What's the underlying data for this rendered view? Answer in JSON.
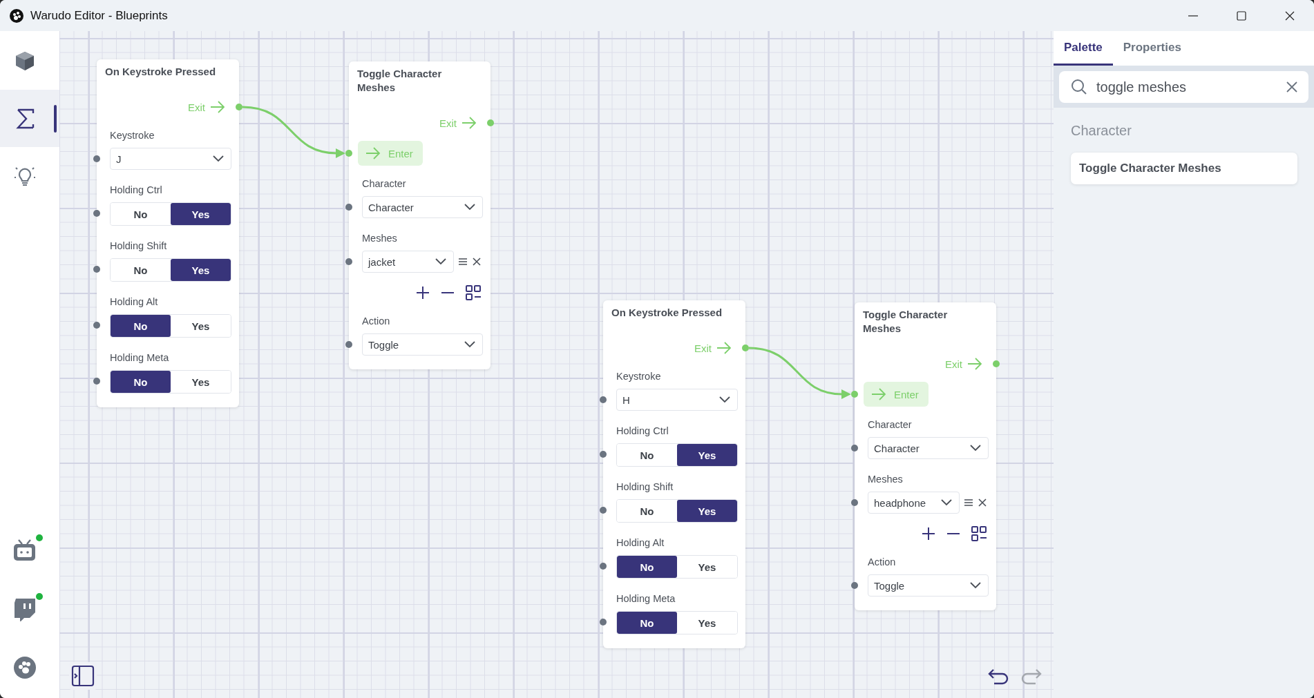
{
  "window": {
    "title": "Warudo Editor - Blueprints"
  },
  "sidebar": {
    "items": [
      {
        "kind": "cube",
        "selected": false
      },
      {
        "kind": "sigma",
        "selected": true
      },
      {
        "kind": "bulb",
        "selected": false
      }
    ],
    "bottom_items": [
      {
        "kind": "tv",
        "online": true
      },
      {
        "kind": "chat",
        "online": true
      },
      {
        "kind": "paw"
      }
    ]
  },
  "nodes": [
    {
      "title": "On Keystroke Pressed",
      "exit_label": "Exit",
      "fields": [
        {
          "kind": "dropdown",
          "label": "Keystroke",
          "value": "J"
        },
        {
          "kind": "toggle",
          "label": "Holding Ctrl",
          "options": [
            {
              "label": "No",
              "selected": false
            },
            {
              "label": "Yes",
              "selected": true
            }
          ]
        },
        {
          "kind": "toggle",
          "label": "Holding Shift",
          "options": [
            {
              "label": "No",
              "selected": false
            },
            {
              "label": "Yes",
              "selected": true
            }
          ]
        },
        {
          "kind": "toggle",
          "label": "Holding Alt",
          "options": [
            {
              "label": "No",
              "selected": true
            },
            {
              "label": "Yes",
              "selected": false
            }
          ]
        },
        {
          "kind": "toggle",
          "label": "Holding Meta",
          "options": [
            {
              "label": "No",
              "selected": true
            },
            {
              "label": "Yes",
              "selected": false
            }
          ]
        }
      ]
    },
    {
      "title": "Toggle Character Meshes",
      "exit_label": "Exit",
      "enter_label": "Enter",
      "enter_wired": true,
      "fields": [
        {
          "kind": "dropdown",
          "label": "Character",
          "value": "Character"
        },
        {
          "kind": "list",
          "label": "Meshes",
          "items": [
            {
              "value": "jacket"
            }
          ]
        },
        {
          "kind": "dropdown",
          "label": "Action",
          "value": "Toggle"
        }
      ]
    },
    {
      "title": "On Keystroke Pressed",
      "exit_label": "Exit",
      "fields": [
        {
          "kind": "dropdown",
          "label": "Keystroke",
          "value": "H"
        },
        {
          "kind": "toggle",
          "label": "Holding Ctrl",
          "options": [
            {
              "label": "No",
              "selected": false
            },
            {
              "label": "Yes",
              "selected": true
            }
          ]
        },
        {
          "kind": "toggle",
          "label": "Holding Shift",
          "options": [
            {
              "label": "No",
              "selected": false
            },
            {
              "label": "Yes",
              "selected": true
            }
          ]
        },
        {
          "kind": "toggle",
          "label": "Holding Alt",
          "options": [
            {
              "label": "No",
              "selected": true
            },
            {
              "label": "Yes",
              "selected": false
            }
          ]
        },
        {
          "kind": "toggle",
          "label": "Holding Meta",
          "options": [
            {
              "label": "No",
              "selected": true
            },
            {
              "label": "Yes",
              "selected": false
            }
          ]
        }
      ]
    },
    {
      "title": "Toggle Character Meshes",
      "exit_label": "Exit",
      "enter_label": "Enter",
      "enter_wired": true,
      "fields": [
        {
          "kind": "dropdown",
          "label": "Character",
          "value": "Character"
        },
        {
          "kind": "list",
          "label": "Meshes",
          "items": [
            {
              "value": "headphone"
            }
          ]
        },
        {
          "kind": "dropdown",
          "label": "Action",
          "value": "Toggle"
        }
      ]
    }
  ],
  "history": {
    "undo_disabled": false,
    "redo_disabled": true
  },
  "panel": {
    "tabs": [
      {
        "label": "Palette",
        "selected": true
      },
      {
        "label": "Properties",
        "selected": false
      }
    ],
    "search": {
      "value": "toggle meshes"
    },
    "groups": [
      {
        "title": "Character",
        "items": [
          "Toggle Character Meshes"
        ]
      }
    ]
  }
}
